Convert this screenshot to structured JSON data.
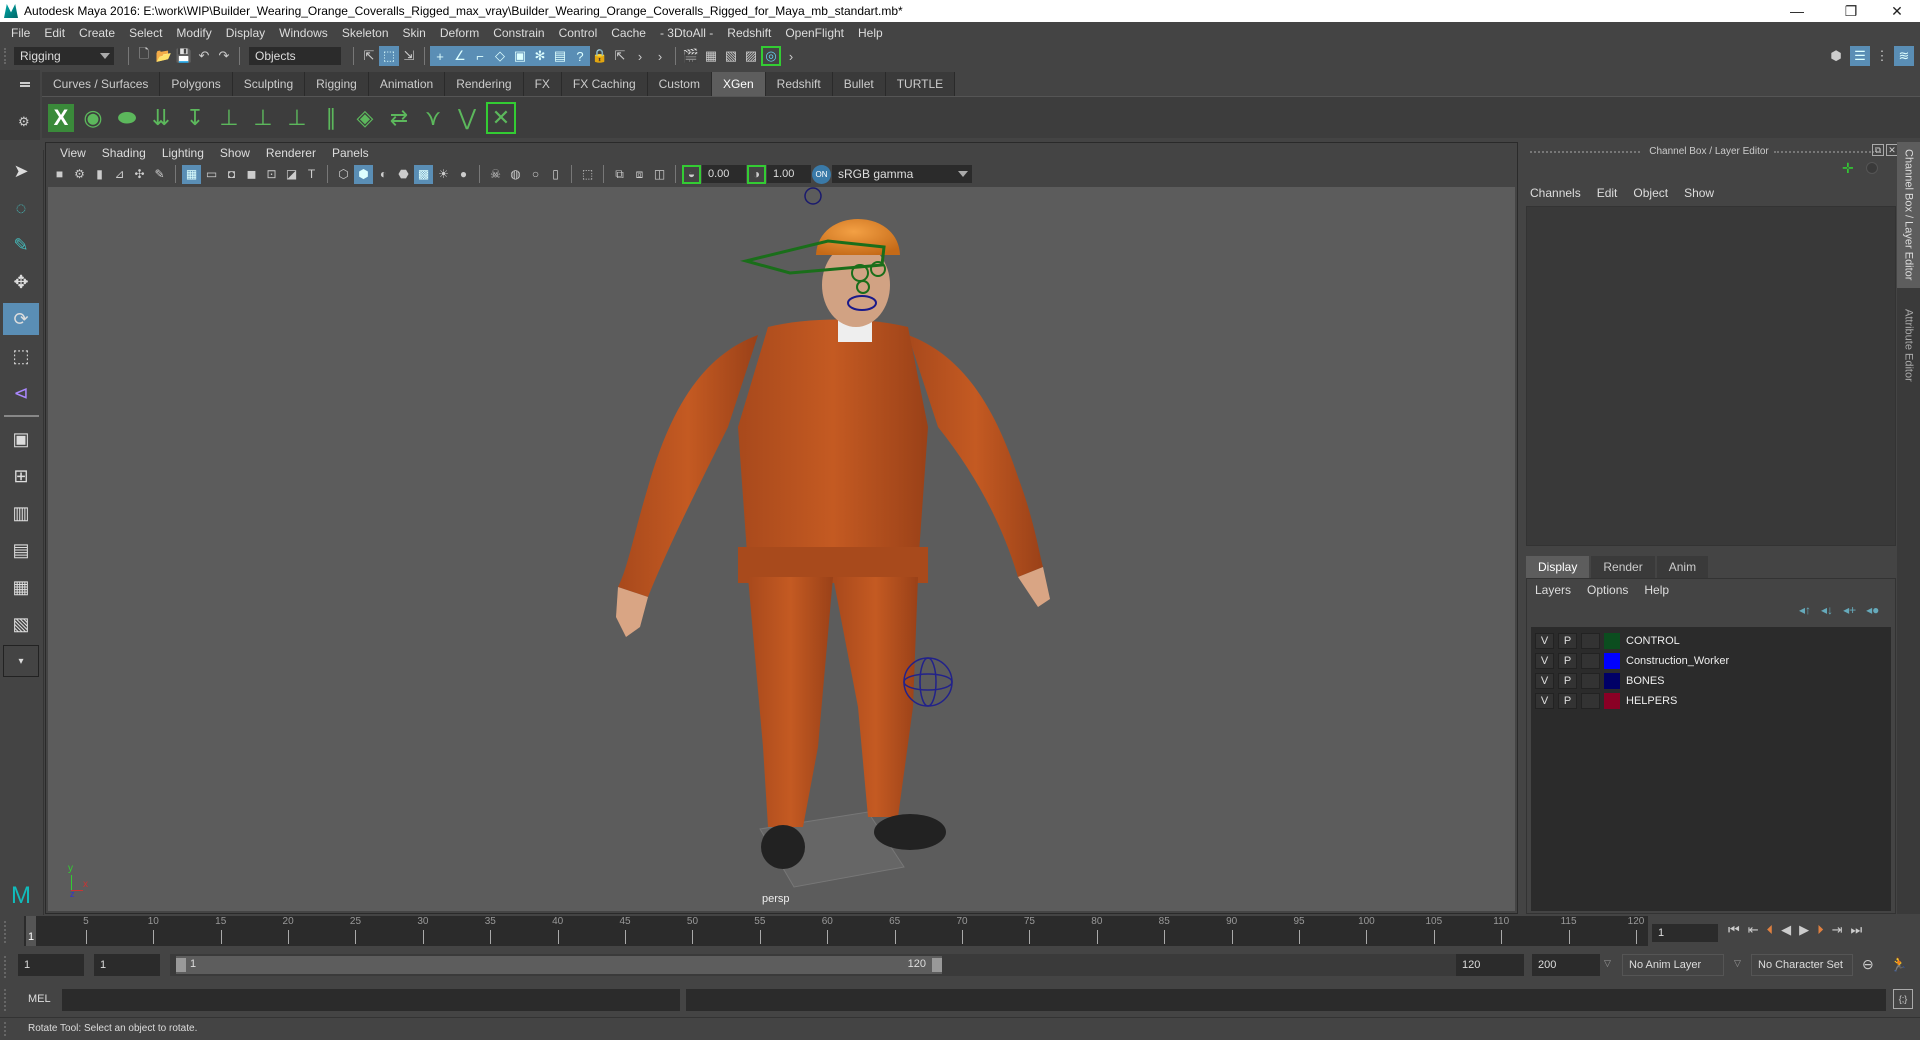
{
  "window": {
    "title": "Autodesk Maya 2016: E:\\work\\WIP\\Builder_Wearing_Orange_Coveralls_Rigged_max_vray\\Builder_Wearing_Orange_Coveralls_Rigged_for_Maya_mb_standart.mb*",
    "minimize": "—",
    "restore": "❐",
    "close": "✕"
  },
  "menubar": [
    "File",
    "Edit",
    "Create",
    "Select",
    "Modify",
    "Display",
    "Windows",
    "Skeleton",
    "Skin",
    "Deform",
    "Constrain",
    "Control",
    "Cache",
    "- 3DtoAll -",
    "Redshift",
    "OpenFlight",
    "Help"
  ],
  "statusline": {
    "menuset": "Rigging",
    "selection_mode": "Objects"
  },
  "shelf": {
    "tabs": [
      "Curves / Surfaces",
      "Polygons",
      "Sculpting",
      "Rigging",
      "Animation",
      "Rendering",
      "FX",
      "FX Caching",
      "Custom",
      "XGen",
      "Redshift",
      "Bullet",
      "TURTLE"
    ],
    "active_tab": "XGen"
  },
  "viewport": {
    "menus": [
      "View",
      "Shading",
      "Lighting",
      "Show",
      "Renderer",
      "Panels"
    ],
    "exposure": "0.00",
    "gamma": "1.00",
    "color_space": "sRGB gamma",
    "camera_label": "persp",
    "axis": {
      "x": "x",
      "y": "y",
      "z": "z"
    }
  },
  "channel_box": {
    "title": "Channel Box / Layer Editor",
    "menus": [
      "Channels",
      "Edit",
      "Object",
      "Show"
    ]
  },
  "layer_editor": {
    "tabs": [
      "Display",
      "Render",
      "Anim"
    ],
    "active_tab": "Display",
    "menus": [
      "Layers",
      "Options",
      "Help"
    ],
    "layers": [
      {
        "v": "V",
        "p": "P",
        "color": "#0b4d1f",
        "name": "CONTROL"
      },
      {
        "v": "V",
        "p": "P",
        "color": "#0000ff",
        "name": "Construction_Worker"
      },
      {
        "v": "V",
        "p": "P",
        "color": "#000066",
        "name": "BONES"
      },
      {
        "v": "V",
        "p": "P",
        "color": "#8a0025",
        "name": "HELPERS"
      }
    ]
  },
  "side_tabs": [
    "Channel Box / Layer Editor",
    "Attribute Editor"
  ],
  "timeline": {
    "ticks": [
      "5",
      "10",
      "15",
      "20",
      "25",
      "30",
      "35",
      "40",
      "45",
      "50",
      "55",
      "60",
      "65",
      "70",
      "75",
      "80",
      "85",
      "90",
      "95",
      "100",
      "105",
      "110",
      "115",
      "120"
    ],
    "current_frame_marker": "1",
    "current_frame": "1",
    "min_frame": 1,
    "max_frame": 120
  },
  "range": {
    "start": "1",
    "playback_start": "1",
    "slider_start": "1",
    "slider_end": "120",
    "playback_end": "120",
    "end": "200",
    "anim_layer": "No Anim Layer",
    "character_set": "No Character Set"
  },
  "command_line": {
    "label": "MEL",
    "value": ""
  },
  "help_line": "Rotate Tool: Select an object to rotate."
}
